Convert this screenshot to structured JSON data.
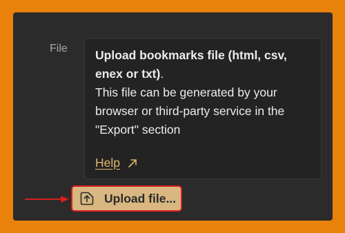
{
  "field": {
    "label": "File"
  },
  "info": {
    "bold_text": "Upload bookmarks file (html, csv, enex or txt)",
    "bold_suffix": ".",
    "body_text": "This file can be generated by your browser or third-party service in the \"Export\" section",
    "help_label": "Help"
  },
  "upload": {
    "button_label": "Upload file..."
  },
  "colors": {
    "background": "#e8820a",
    "panel": "#2b2b2b",
    "help_link": "#e0b86a",
    "button_fill": "#d8b880",
    "highlight": "#d81e1e"
  },
  "icons": {
    "help": "external-link-arrow-icon",
    "upload": "upload-file-icon",
    "annotation": "pointer-arrow-icon"
  }
}
